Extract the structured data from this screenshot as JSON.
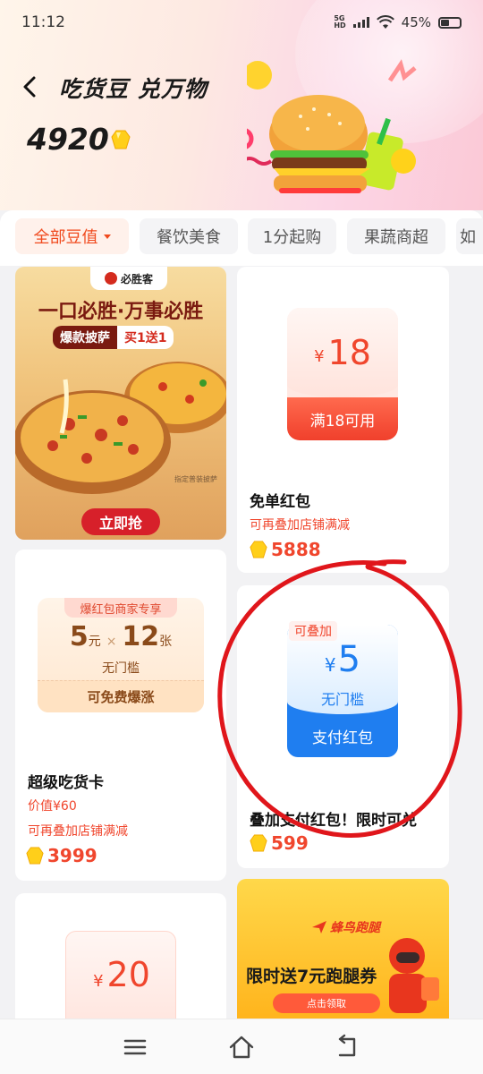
{
  "status": {
    "time": "11:12",
    "signal_label_top": "5G",
    "signal_label_bottom": "HD",
    "battery": "45%"
  },
  "header": {
    "title": "吃货豆 兑万物",
    "balance": "4920"
  },
  "tabs": [
    {
      "label": "全部豆值",
      "active": true
    },
    {
      "label": "餐饮美食",
      "active": false
    },
    {
      "label": "1分起购",
      "active": false
    },
    {
      "label": "果蔬商超",
      "active": false
    },
    {
      "label": "如",
      "active": false
    }
  ],
  "pizza_ad": {
    "brand": "必胜客",
    "slogan": "一口必胜·万事必胜",
    "tag1": "爆款披萨",
    "tag2": "买1送1",
    "note": "指定普装披萨",
    "cta": "立即抢"
  },
  "cards": {
    "free_order": {
      "currency": "¥",
      "amount": "18",
      "condition": "满18可用",
      "title": "免单红包",
      "subtitle": "可再叠加店铺满减",
      "price": "5888"
    },
    "super_card": {
      "badge": "爆红包商家专享",
      "amount_a": "5",
      "unit_a": "元",
      "times": "×",
      "amount_b": "12",
      "unit_b": "张",
      "threshold": "无门槛",
      "footer": "可免费爆涨",
      "title": "超级吃货卡",
      "value_line": "价值¥60",
      "subtitle": "可再叠加店铺满减",
      "price": "3999"
    },
    "pay_red": {
      "stack_tag": "可叠加",
      "currency": "¥",
      "amount": "5",
      "threshold": "无门槛",
      "footer": "支付红包",
      "title": "叠加支付红包！限时可兑",
      "price": "599"
    },
    "red20": {
      "currency": "¥",
      "amount": "20"
    },
    "delivery_ad": {
      "brand": "蜂鸟跑腿",
      "headline": "限时送7元跑腿券",
      "cta": "点击领取"
    }
  },
  "colors": {
    "accent": "#f0462d",
    "blue": "#1f7ef0"
  }
}
